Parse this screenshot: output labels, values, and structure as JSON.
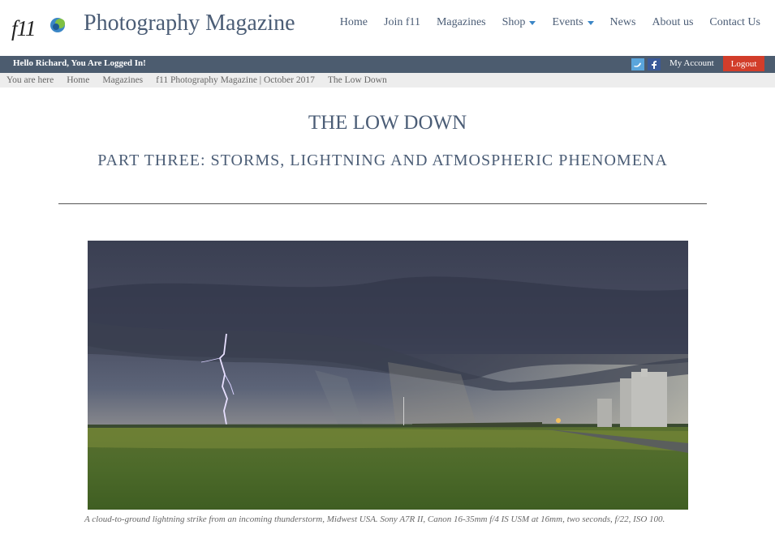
{
  "site": {
    "logo_text": "f11",
    "title": "Photography Magazine"
  },
  "nav": [
    {
      "label": "Home",
      "dropdown": false
    },
    {
      "label": "Join f11",
      "dropdown": false
    },
    {
      "label": "Magazines",
      "dropdown": false
    },
    {
      "label": "Shop",
      "dropdown": true
    },
    {
      "label": "Events",
      "dropdown": true
    },
    {
      "label": "News",
      "dropdown": false
    },
    {
      "label": "About us",
      "dropdown": false
    },
    {
      "label": "Contact Us",
      "dropdown": false
    }
  ],
  "userbar": {
    "greeting": "Hello Richard, You Are Logged In!",
    "twitter_icon": "twitter-icon",
    "facebook_icon": "facebook-icon",
    "my_account": "My Account",
    "logout": "Logout"
  },
  "breadcrumb": [
    "You are here",
    "Home",
    "Magazines",
    "f11 Photography Magazine | October 2017",
    "The Low Down"
  ],
  "article": {
    "title": "THE LOW DOWN",
    "subtitle": "PART THREE: STORMS, LIGHTNING AND ATMOSPHERIC PHENOMENA",
    "caption": "A cloud-to-ground lightning strike from an incoming thunderstorm, Midwest USA. Sony A7R II, Canon 16-35mm f/4 IS USM at 16mm, two seconds, f/22, ISO 100."
  },
  "colors": {
    "brand": "#4b5d76",
    "userbar": "#4c5c6f",
    "logout": "#d23d2a",
    "dropdown_caret": "#3b86c6"
  }
}
